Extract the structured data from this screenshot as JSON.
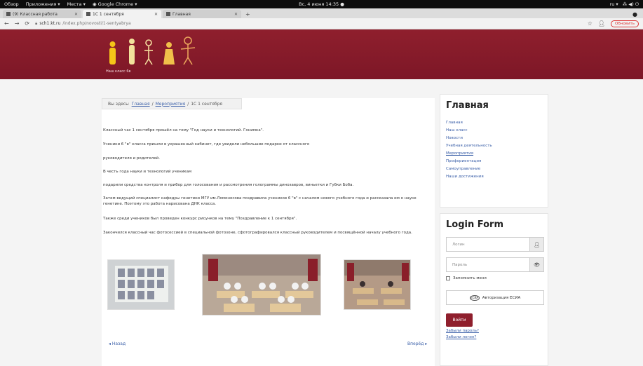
{
  "os": {
    "left_items": [
      "Обзор",
      "Приложения ▾",
      "Места ▾",
      "◉ Google Chrome ▾"
    ],
    "clock": "Вс, 4 июня 14:35 ●",
    "right_items": [
      "ru ▾",
      "⁂ ◀) ⏻"
    ]
  },
  "tabs": [
    {
      "label": "(9) Классная работа",
      "active": false
    },
    {
      "label": "1С 1 сентября",
      "active": true
    },
    {
      "label": "Главная",
      "active": false
    }
  ],
  "addr": {
    "url_domain": "sch1.kt.ru",
    "url_rest": "/index.php/novosti/1-sentyabrya",
    "update_label": "Обновить"
  },
  "header": {
    "logo_caption": "Наш класс 6в"
  },
  "breadcrumb": {
    "prefix": "Вы здесь:",
    "home": "Главная",
    "section": "Мероприятия",
    "current": "1С 1 сентября"
  },
  "article": {
    "paragraphs": [
      "Классный час 1 сентября прошёл на тему \"Год науки и технологий. Гонимка\".",
      "Ученики 6 \"в\" класса пришли в украшенный кабинет, где увидели небольшие подарки от классного",
      "руководителя и родителей.",
      "В честь года науки и технологий ученикам",
      "подарили средства контроля и прибор для голосования и рассмотрения голограммы динозавров, виньетки и Губки Боба.",
      "Затем ведущий специалист кафедры генетики МГУ им.Ломоносова поздравила учеников 6 \"в\" с началом нового учебного года и рассказала им о науке генетике. Поэтому это работа нарисована ДНК класса.",
      "Также среди учеников был проведен конкурс рисунков на тему \"Поздравление к 1 сентября\".",
      "Закончился классный час фотосессией в специальной фотозоне, сфотографировался классный руководителем и посвящённой началу учебного года."
    ]
  },
  "pager": {
    "prev": "◂ Назад",
    "next": "Вперёд ▸"
  },
  "sidebar": {
    "title": "Главная",
    "items": [
      {
        "label": "Главная",
        "underline": false
      },
      {
        "label": "Наш класс",
        "underline": false
      },
      {
        "label": "Новости",
        "underline": false
      },
      {
        "label": "Учебная деятельность",
        "underline": false
      },
      {
        "label": "Мероприятия",
        "underline": true
      },
      {
        "label": "Профориентация",
        "underline": false
      },
      {
        "label": "Самоуправление",
        "underline": false
      },
      {
        "label": "Наши достижения",
        "underline": false
      }
    ]
  },
  "login": {
    "title": "Login Form",
    "user_placeholder": "Логин",
    "pass_placeholder": "Пароль",
    "remember": "Запомнить меня",
    "esia_label": "Авторизация ЕСИА",
    "esia_logo": "ЕСИА",
    "login_button": "Войти",
    "forgot_password": "Забыли пароль?",
    "forgot_login": "Забыли логин?"
  },
  "colors": {
    "brand": "#8f1f2d",
    "link": "#3a5fa8"
  }
}
